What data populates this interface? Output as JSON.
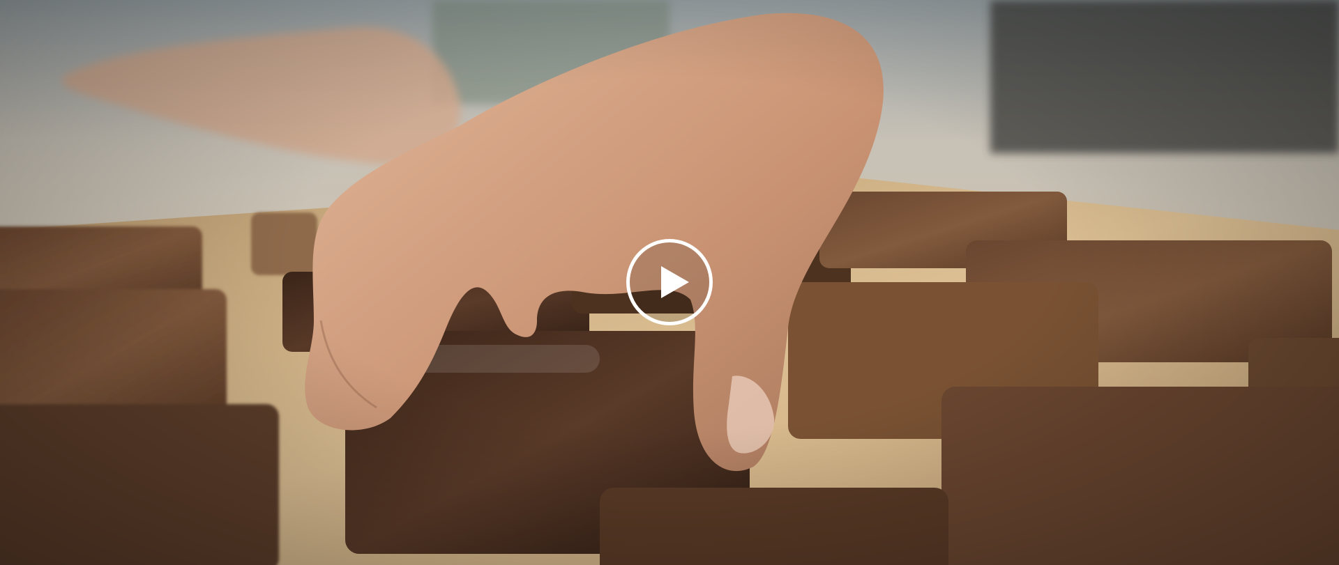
{
  "video": {
    "play_button": {
      "icon": "play-icon"
    },
    "colors": {
      "wood_dark": "#4a2f1f",
      "wood_light": "#c49a6c",
      "board": "#d8b98d",
      "rug": "#cfc6b8",
      "skin": "#c99a7e",
      "overlay_icon": "#ffffff"
    }
  }
}
